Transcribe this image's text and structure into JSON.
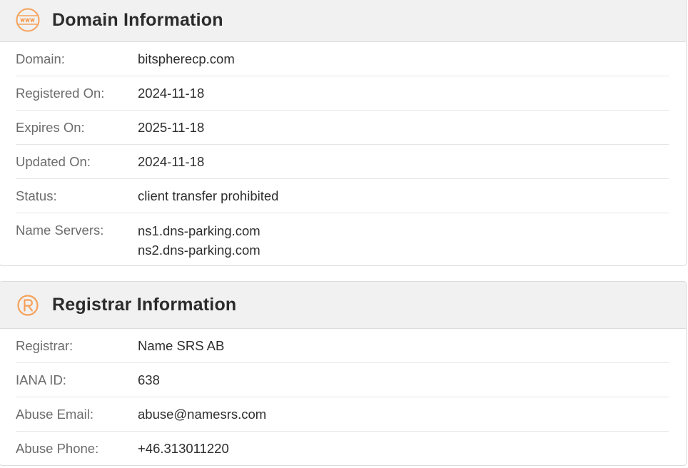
{
  "domain_info": {
    "title": "Domain Information",
    "icon": "www-icon",
    "accent_color": "#f5a15a",
    "rows": [
      {
        "label": "Domain:",
        "value": "bitspherecp.com"
      },
      {
        "label": "Registered On:",
        "value": "2024-11-18"
      },
      {
        "label": "Expires On:",
        "value": "2025-11-18"
      },
      {
        "label": "Updated On:",
        "value": "2024-11-18"
      },
      {
        "label": "Status:",
        "value": "client transfer prohibited"
      }
    ],
    "name_servers": {
      "label": "Name Servers:",
      "values": [
        "ns1.dns-parking.com",
        "ns2.dns-parking.com"
      ]
    }
  },
  "registrar_info": {
    "title": "Registrar Information",
    "icon": "registered-icon",
    "rows": [
      {
        "label": "Registrar:",
        "value": "Name SRS AB"
      },
      {
        "label": "IANA ID:",
        "value": "638"
      },
      {
        "label": "Abuse Email:",
        "value": "abuse@namesrs.com"
      },
      {
        "label": "Abuse Phone:",
        "value": "+46.313011220"
      }
    ]
  }
}
